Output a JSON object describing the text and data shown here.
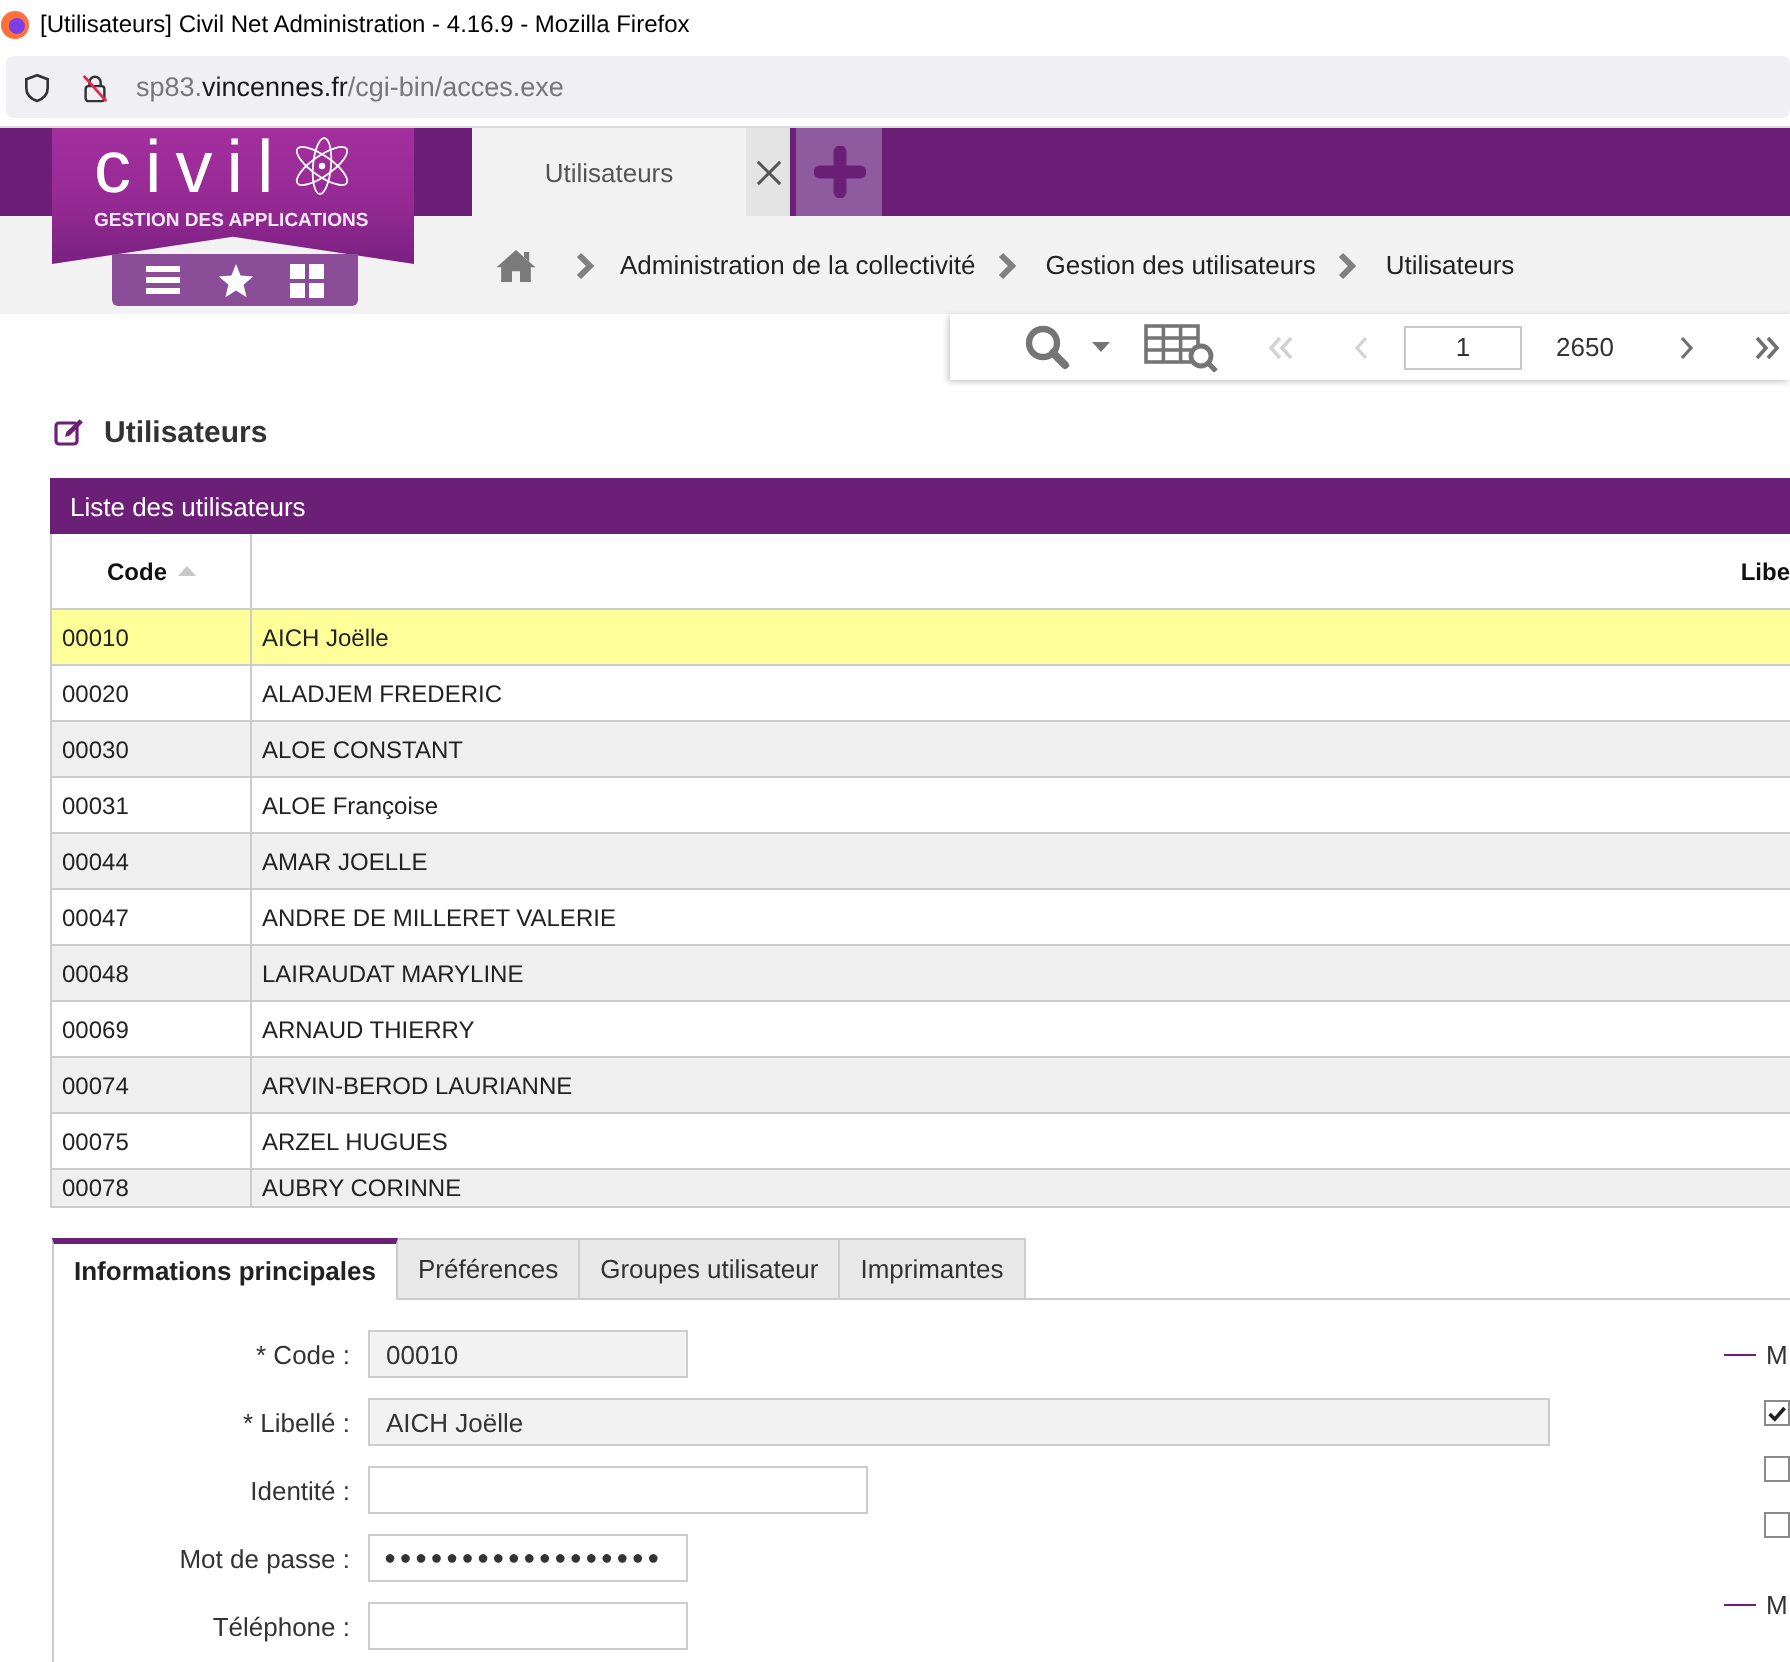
{
  "browser": {
    "title": "[Utilisateurs] Civil Net Administration - 4.16.9 - Mozilla Firefox",
    "url": {
      "subdomain": "sp83.",
      "domain": "vincennes.fr",
      "path": "/cgi-bin/acces.exe"
    }
  },
  "logo": {
    "wordmark": "civil",
    "tagline": "GESTION DES APPLICATIONS"
  },
  "app_tabs": [
    {
      "label": "Utilisateurs",
      "selected": true
    }
  ],
  "breadcrumb": [
    "Administration de la collectivité",
    "Gestion des utilisateurs",
    "Utilisateurs"
  ],
  "pager": {
    "first": {
      "disabled": true
    },
    "previous": {
      "disabled": true
    },
    "page": "1",
    "total": "2650",
    "next": {
      "disabled": false
    },
    "last": {
      "disabled": false
    }
  },
  "page_title": "Utilisateurs",
  "table": {
    "title": "Liste des utilisateurs",
    "columns": [
      {
        "label": "Code",
        "sorted_ascending": true
      },
      {
        "label": "Libe"
      }
    ],
    "rows": [
      {
        "cells": [
          "00010",
          "AICH Joëlle"
        ],
        "selected": true
      },
      {
        "cells": [
          "00020",
          "ALADJEM FREDERIC"
        ],
        "selected": false
      },
      {
        "cells": [
          "00030",
          "ALOE CONSTANT"
        ],
        "selected": false
      },
      {
        "cells": [
          "00031",
          "ALOE Françoise"
        ],
        "selected": false
      },
      {
        "cells": [
          "00044",
          "AMAR JOELLE"
        ],
        "selected": false
      },
      {
        "cells": [
          "00047",
          "ANDRE DE MILLERET VALERIE"
        ],
        "selected": false
      },
      {
        "cells": [
          "00048",
          "LAIRAUDAT MARYLINE"
        ],
        "selected": false
      },
      {
        "cells": [
          "00069",
          "ARNAUD THIERRY"
        ],
        "selected": false
      },
      {
        "cells": [
          "00074",
          "ARVIN-BEROD LAURIANNE"
        ],
        "selected": false
      },
      {
        "cells": [
          "00075",
          "ARZEL HUGUES"
        ],
        "selected": false
      },
      {
        "cells": [
          "00078",
          "AUBRY CORINNE"
        ],
        "selected": false
      }
    ]
  },
  "form_tabs": [
    {
      "label": "Informations principales",
      "selected": true
    },
    {
      "label": "Préférences",
      "selected": false
    },
    {
      "label": "Groupes utilisateur",
      "selected": false
    },
    {
      "label": "Imprimantes",
      "selected": false
    }
  ],
  "form": {
    "fields": [
      {
        "label": "* Code :",
        "value": "00010",
        "readonly": true
      },
      {
        "label": "* Libellé :",
        "value": "AICH Joëlle",
        "readonly": true
      },
      {
        "label": "Identité :",
        "readonly": false
      },
      {
        "label": "Mot de passe :",
        "value": "●●●●●●●●●●●●●●●●●●",
        "readonly": false
      },
      {
        "label": "Téléphone :",
        "readonly": false
      }
    ]
  },
  "side_sections": [
    {
      "legend": "M",
      "checkboxes": [
        {
          "checked": true
        },
        {
          "checked": false
        },
        {
          "checked": false
        }
      ]
    },
    {
      "legend": "M"
    }
  ]
}
